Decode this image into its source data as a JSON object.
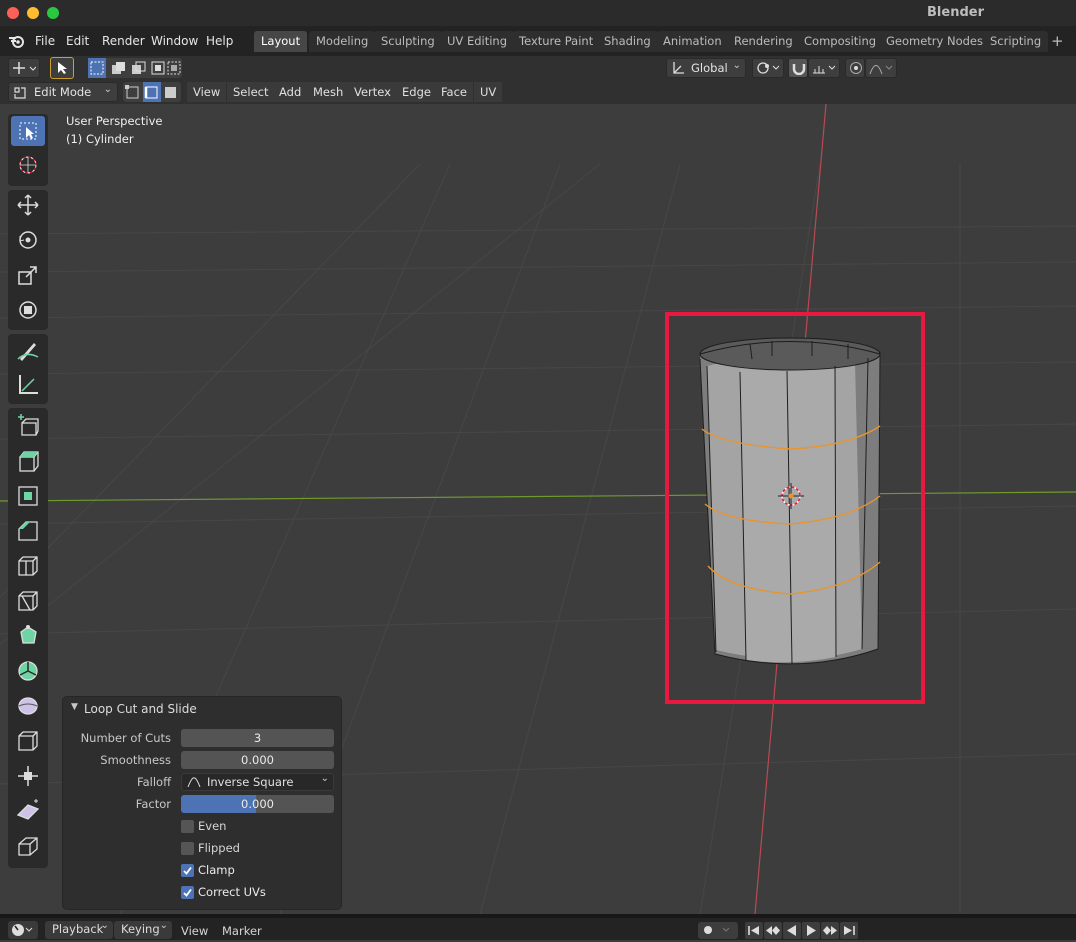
{
  "window": {
    "title": "Blender",
    "traffic_colors": [
      "#fe5f57",
      "#febc2e",
      "#28c840"
    ]
  },
  "menubar": {
    "items": [
      "File",
      "Edit",
      "Render",
      "Window",
      "Help"
    ]
  },
  "workspaces": {
    "tabs": [
      "Layout",
      "Modeling",
      "Sculpting",
      "UV Editing",
      "Texture Paint",
      "Shading",
      "Animation",
      "Rendering",
      "Compositing",
      "Geometry Nodes",
      "Scripting"
    ],
    "active": "Layout",
    "add_label": "+"
  },
  "header": {
    "orientation": "Global",
    "mode": "Edit Mode",
    "menus": [
      "View",
      "Select",
      "Add",
      "Mesh",
      "Vertex",
      "Edge",
      "Face",
      "UV"
    ]
  },
  "viewport": {
    "perspective": "User Perspective",
    "object": "(1) Cylinder",
    "highlight_color": "#e8183e",
    "edge_loop_color": "#e8952e"
  },
  "tools": [
    "select-box-icon",
    "cursor-icon",
    "move-icon",
    "rotate-icon",
    "scale-icon",
    "transform-icon",
    "annotate-icon",
    "measure-icon",
    "add-cube-icon",
    "extrude-icon",
    "inset-icon",
    "bevel-icon",
    "loop-cut-icon",
    "knife-icon",
    "poly-build-icon",
    "spin-icon",
    "smooth-icon",
    "edge-slide-icon",
    "shrink-fatten-icon",
    "shear-icon",
    "rip-icon"
  ],
  "operator_panel": {
    "title": "Loop Cut and Slide",
    "fields": [
      {
        "label": "Number of Cuts",
        "value": "3"
      },
      {
        "label": "Smoothness",
        "value": "0.000"
      },
      {
        "label": "Falloff",
        "value": "Inverse Square"
      },
      {
        "label": "Factor",
        "value": "0.000"
      }
    ],
    "checkboxes": [
      {
        "label": "Even",
        "checked": false
      },
      {
        "label": "Flipped",
        "checked": false
      },
      {
        "label": "Clamp",
        "checked": true
      },
      {
        "label": "Correct UVs",
        "checked": true
      }
    ]
  },
  "timeline": {
    "menus": [
      "Playback",
      "Keying",
      "View",
      "Marker"
    ]
  }
}
